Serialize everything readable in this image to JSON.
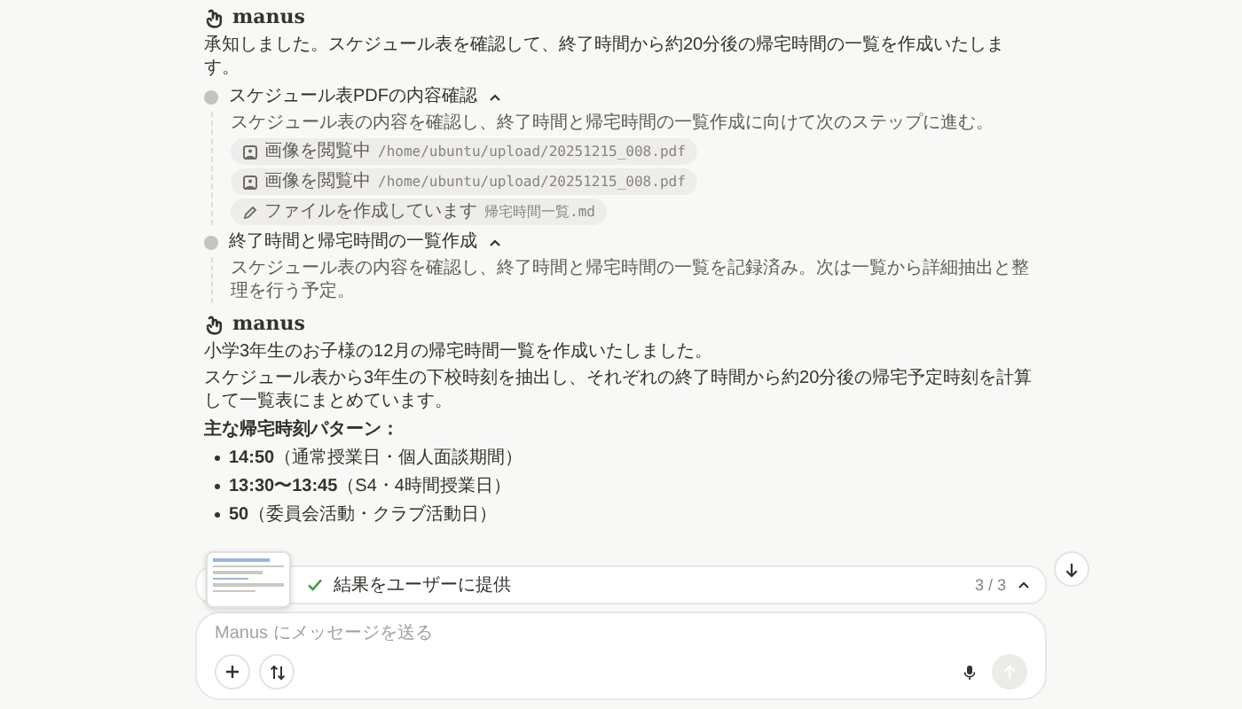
{
  "messages": [
    {
      "sender": "manus",
      "paragraphs": [
        "承知しました。スケジュール表を確認して、終了時間から約20分後の帰宅時間の一覧を作成いたします。"
      ],
      "steps": [
        {
          "title": "スケジュール表PDFの内容確認",
          "expanded": true,
          "description": "スケジュール表の内容を確認し、終了時間と帰宅時間の一覧作成に向けて次のステップに進む。",
          "actions": [
            {
              "kind": "view",
              "label": "画像を閲覧中",
              "target": "/home/ubuntu/upload/20251215_008.pdf"
            },
            {
              "kind": "view",
              "label": "画像を閲覧中",
              "target": "/home/ubuntu/upload/20251215_008.pdf"
            },
            {
              "kind": "edit",
              "label": "ファイルを作成しています",
              "target": "帰宅時間一覧.md"
            }
          ]
        },
        {
          "title": "終了時間と帰宅時間の一覧作成",
          "expanded": true,
          "description": "スケジュール表の内容を確認し、終了時間と帰宅時間の一覧を記録済み。次は一覧から詳細抽出と整理を行う予定。"
        }
      ]
    },
    {
      "sender": "manus",
      "paragraphs": [
        "小学3年生のお子様の12月の帰宅時間一覧を作成いたしました。",
        "スケジュール表から3年生の下校時刻を抽出し、それぞれの終了時間から約20分後の帰宅予定時刻を計算して一覧表にまとめています。"
      ],
      "heading": "主な帰宅時刻パターン：",
      "bullets": [
        {
          "time": "14:50",
          "note": "（通常授業日・個人面談期間）"
        },
        {
          "time": "13:30〜13:45",
          "note": "（S4・4時間授業日）"
        },
        {
          "time": "50",
          "note": "（委員会活動・クラブ活動日）"
        }
      ]
    }
  ],
  "progress": {
    "done": true,
    "label": "結果をユーザーに提供",
    "count": "3 / 3",
    "expanded": false
  },
  "composer": {
    "placeholder": "Manus にメッセージを送る",
    "send_disabled": true
  }
}
